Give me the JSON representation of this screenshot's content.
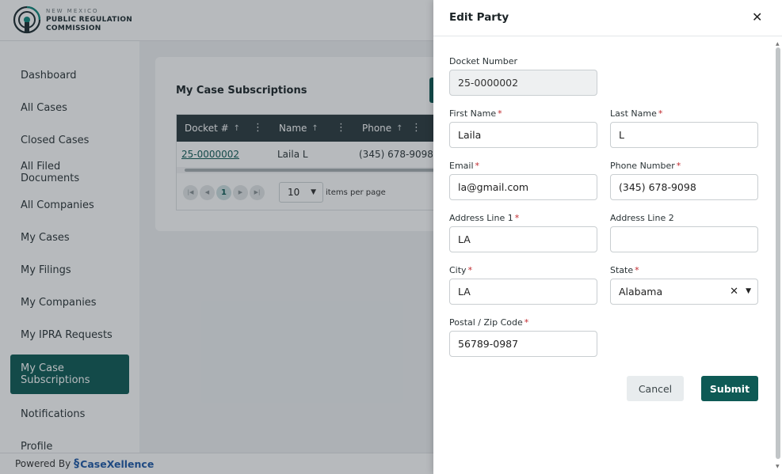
{
  "brand": {
    "line1": "NEW MEXICO",
    "line2": "PUBLIC REGULATION",
    "line3": "COMMISSION",
    "accent_color": "#0e5a55"
  },
  "sidebar": {
    "items": [
      {
        "label": "Dashboard"
      },
      {
        "label": "All Cases"
      },
      {
        "label": "Closed Cases"
      },
      {
        "label": "All Filed Documents"
      },
      {
        "label": "All Companies"
      },
      {
        "label": "My Cases"
      },
      {
        "label": "My Filings"
      },
      {
        "label": "My Companies"
      },
      {
        "label": "My IPRA Requests"
      },
      {
        "label": "My Case Subscriptions",
        "active": true
      },
      {
        "label": "Notifications"
      },
      {
        "label": "Profile"
      }
    ]
  },
  "footer": {
    "powered_by": "Powered By",
    "brand_name": "CaseXellence"
  },
  "subscriptions": {
    "title": "My Case Subscriptions",
    "columns": [
      "Docket #",
      "Name",
      "Phone"
    ],
    "rows": [
      {
        "docket": "25-0000002",
        "name": "Laila L",
        "phone": "(345) 678-9098"
      }
    ],
    "pager": {
      "current_page": "1",
      "page_size": "10",
      "page_size_label": "items per page"
    }
  },
  "drawer": {
    "title": "Edit Party",
    "close_icon": "close-icon",
    "fields": {
      "docket_number": {
        "label": "Docket Number",
        "value": "25-0000002"
      },
      "first_name": {
        "label": "First Name",
        "value": "Laila"
      },
      "last_name": {
        "label": "Last Name",
        "value": "L"
      },
      "email": {
        "label": "Email",
        "value": "la@gmail.com"
      },
      "phone": {
        "label": "Phone Number",
        "value": "(345) 678-9098"
      },
      "address1": {
        "label": "Address Line 1",
        "value": "LA"
      },
      "address2": {
        "label": "Address Line 2",
        "value": ""
      },
      "city": {
        "label": "City",
        "value": "LA"
      },
      "state": {
        "label": "State",
        "value": "Alabama"
      },
      "zip": {
        "label": "Postal / Zip Code",
        "value": "56789-0987"
      }
    },
    "required_mark": "*",
    "cancel_label": "Cancel",
    "submit_label": "Submit"
  }
}
